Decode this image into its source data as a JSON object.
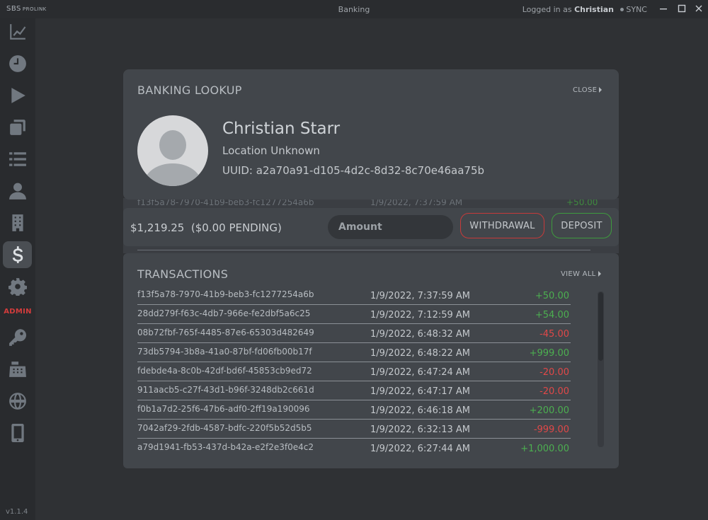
{
  "titlebar": {
    "brand": "SBS",
    "brand_sub": "PROLINK",
    "window_title": "Banking",
    "logged_prefix": "Logged in as",
    "logged_user": "Christian",
    "sync_label": "SYNC"
  },
  "sidebar": {
    "admin_label": "ADMIN",
    "version": "v1.1.4",
    "items": [
      {
        "icon": "chart-icon"
      },
      {
        "icon": "clock-icon"
      },
      {
        "icon": "play-icon"
      },
      {
        "icon": "copy-icon"
      },
      {
        "icon": "list-icon"
      },
      {
        "icon": "user-icon"
      },
      {
        "icon": "building-icon"
      },
      {
        "icon": "dollar-icon",
        "active": true
      },
      {
        "icon": "gear-icon"
      },
      {
        "icon": "key-icon"
      },
      {
        "icon": "keypad-icon"
      },
      {
        "icon": "globe-icon"
      },
      {
        "icon": "phone-icon"
      }
    ]
  },
  "lookup": {
    "title": "BANKING LOOKUP",
    "close_label": "CLOSE",
    "name": "Christian Starr",
    "location": "Location Unknown",
    "uuid": "UUID: a2a70a91-d105-4d2c-8d32-8c70e46aa75b"
  },
  "account": {
    "balance": "$1,219.25  ($0.00 PENDING)",
    "amount_placeholder": "Amount",
    "withdraw_label": "WITHDRAWAL",
    "deposit_label": "DEPOSIT"
  },
  "transactions": {
    "title": "TRANSACTIONS",
    "view_all_label": "VIEW ALL",
    "rows": [
      {
        "id": "f13f5a78-7970-41b9-beb3-fc1277254a6b",
        "date": "1/9/2022, 7:37:59 AM",
        "amount": "+50.00",
        "type": "pos"
      },
      {
        "id": "28dd279f-f63c-4db7-966e-fe2dbf5a6c25",
        "date": "1/9/2022, 7:12:59 AM",
        "amount": "+54.00",
        "type": "pos"
      },
      {
        "id": "08b72fbf-765f-4485-87e6-65303d482649",
        "date": "1/9/2022, 6:48:32 AM",
        "amount": "-45.00",
        "type": "neg"
      },
      {
        "id": "73db5794-3b8a-41a0-87bf-fd06fb00b17f",
        "date": "1/9/2022, 6:48:22 AM",
        "amount": "+999.00",
        "type": "pos"
      },
      {
        "id": "fdebde4a-8c0b-42df-bd6f-45853cb9ed72",
        "date": "1/9/2022, 6:47:24 AM",
        "amount": "-20.00",
        "type": "neg"
      },
      {
        "id": "911aacb5-c27f-43d1-b96f-3248db2c661d",
        "date": "1/9/2022, 6:47:17 AM",
        "amount": "-20.00",
        "type": "neg"
      },
      {
        "id": "f0b1a7d2-25f6-47b6-adf0-2ff19a190096",
        "date": "1/9/2022, 6:46:18 AM",
        "amount": "+200.00",
        "type": "pos"
      },
      {
        "id": "7042af29-2fdb-4587-bdfc-220f5b52d5b5",
        "date": "1/9/2022, 6:32:13 AM",
        "amount": "-999.00",
        "type": "neg"
      },
      {
        "id": "a79d1941-fb53-437d-b42a-e2f2e3f0e4c2",
        "date": "1/9/2022, 6:27:44 AM",
        "amount": "+1,000.00",
        "type": "pos"
      }
    ]
  },
  "colors": {
    "positive": "#4caf50",
    "negative": "#e04848",
    "admin": "#d33c3c"
  }
}
